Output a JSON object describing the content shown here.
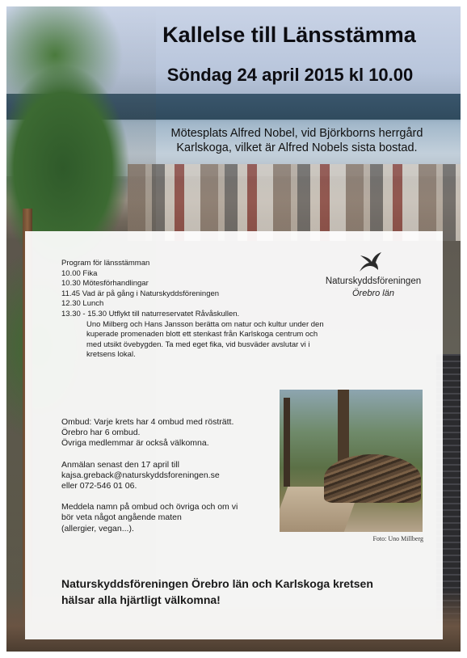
{
  "header": {
    "title": "Kallelse till Länsstämma",
    "date": "Söndag 24 april 2015 kl 10.00",
    "venue_lines": [
      "Mötesplats Alfred Nobel, vid Björkborns herrgård",
      "Karlskoga, vilket är Alfred Nobels sista bostad."
    ]
  },
  "program": {
    "heading": "Program för länsstämman",
    "items": [
      "10.00 Fika",
      "10.30 Mötesförhandlingar",
      "11.45 Vad är på gång i Naturskyddsföreningen",
      "12.30 Lunch",
      "13.30 - 15.30 Utflykt till naturreservatet Råvåskullen."
    ],
    "description_lines": [
      "Uno Milberg och Hans Jansson berätta om natur och kultur under den",
      "kuperade promenaden blott ett stenkast från Karlskoga centrum och",
      "med utsikt övebygden. Ta med eget fika, vid busväder avslutar vi i",
      "kretsens lokal."
    ]
  },
  "logo": {
    "name": "Naturskyddsföreningen",
    "region": "Örebro län",
    "icon": "swallow-bird-icon"
  },
  "info": {
    "delegates": [
      "Ombud: Varje krets har 4 ombud med rösträtt.",
      "Örebro har 6 ombud.",
      "Övriga medlemmar är också välkomna."
    ],
    "registration": [
      "Anmälan senast den 17 april till",
      "kajsa.greback@naturskyddsforeningen.se",
      "eller 072-546 01 06."
    ],
    "food": [
      "Meddela namn på ombud och övriga och om vi",
      "bör veta något angående maten",
      "(allergier, vegan...)."
    ]
  },
  "photo": {
    "credit": "Foto: Uno Millberg"
  },
  "closing": {
    "lines": [
      "Naturskyddsföreningen Örebro län och Karlskoga kretsen",
      "hälsar alla hjärtligt välkomna!"
    ]
  }
}
